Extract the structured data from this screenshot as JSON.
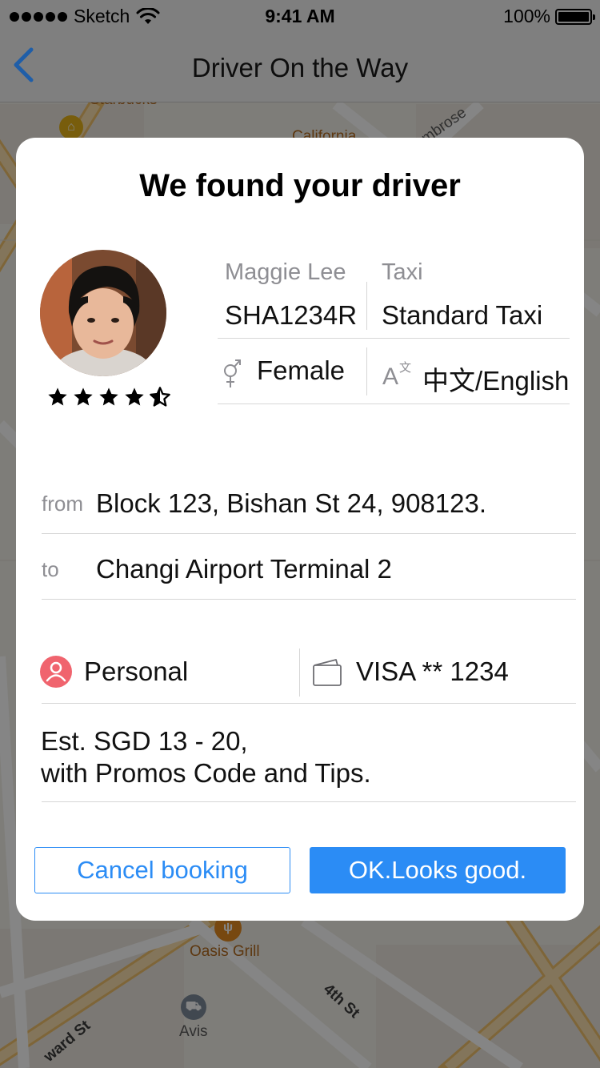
{
  "status_bar": {
    "carrier": "Sketch",
    "time": "9:41 AM",
    "battery": "100%"
  },
  "nav": {
    "title": "Driver On the Way",
    "back_icon": "chevron-left-icon"
  },
  "map": {
    "labels": {
      "starbucks": "Starbucks",
      "california": "California",
      "ambrose": "Ambrose",
      "oasis_grill": "Oasis Grill",
      "fourth_st": "4th St",
      "avis": "Avis",
      "ward_st": "ward St"
    }
  },
  "card": {
    "title": "We found your driver",
    "driver": {
      "name": "Maggie Lee",
      "plate": "SHA1234R",
      "vehicle_type_label": "Taxi",
      "vehicle_type": "Standard Taxi",
      "gender": "Female",
      "gender_icon": "gender-icon",
      "languages": "中文/English",
      "language_icon": "translate-icon",
      "rating": 4.5,
      "rating_max": 5
    },
    "route": {
      "from_label": "from",
      "from_value": "Block 123, Bishan St 24, 908123.",
      "to_label": "to",
      "to_value": "Changi Airport Terminal 2"
    },
    "payment": {
      "profile": "Personal",
      "profile_icon": "person-icon",
      "method": "VISA ** 1234",
      "method_icon": "wallet-icon"
    },
    "estimate": {
      "line1": "Est. SGD 13 - 20,",
      "line2": "with Promos Code and Tips."
    },
    "buttons": {
      "cancel": "Cancel booking",
      "ok": "OK.Looks good."
    }
  },
  "colors": {
    "accent": "#2b8cf5",
    "profile_badge": "#f0646e",
    "secondary_text": "#8e8e93"
  }
}
